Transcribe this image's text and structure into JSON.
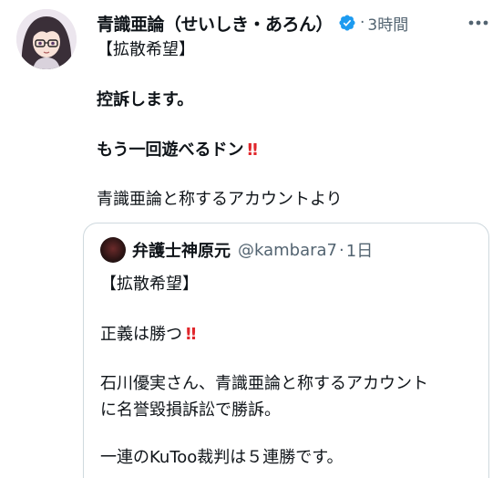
{
  "tweet": {
    "display_name": "青識亜論（せいしき・あろん）",
    "timestamp": "3時間",
    "separator": "·",
    "lines": [
      "【拡散希望】",
      "控訴します。",
      "もう一回遊べるドン",
      "青識亜論と称するアカウントより"
    ],
    "emoji_text": "‼"
  },
  "quote": {
    "display_name": "弁護士神原元",
    "handle": "@kambara7",
    "separator": "·",
    "timestamp": "1日",
    "lines": [
      "【拡散希望】",
      "正義は勝つ",
      "石川優実さん、青識亜論と称するアカウント",
      "に名誉毀損訴訟で勝訴。",
      "一連のKuToo裁判は５連勝です。"
    ],
    "emoji_text": "‼"
  },
  "icons": {
    "verified": "verified-badge-icon",
    "more": "more-dots-icon"
  },
  "colors": {
    "verified": "#1d9bf0",
    "secondary_text": "#536471",
    "emoji_red": "#e0262b",
    "border": "#cfd9de"
  }
}
